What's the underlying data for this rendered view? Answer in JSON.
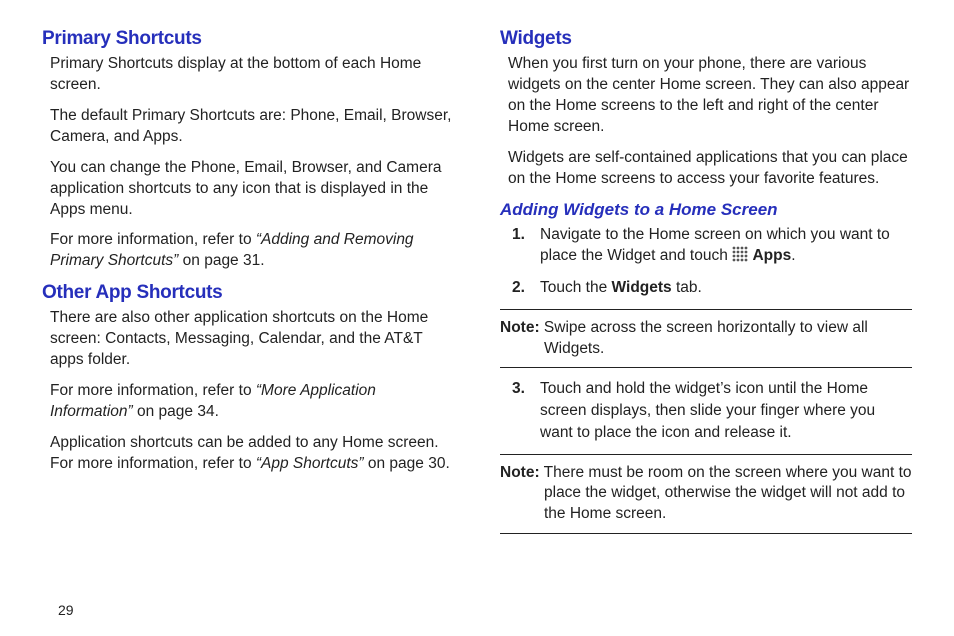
{
  "page_number": "29",
  "left": {
    "primary": {
      "heading": "Primary Shortcuts",
      "p1": "Primary Shortcuts display at the bottom of each Home screen.",
      "p2": "The default Primary Shortcuts are: Phone, Email, Browser, Camera, and Apps.",
      "p3": "You can change the Phone, Email, Browser, and Camera application shortcuts to any icon that is displayed in the Apps menu.",
      "p4_pre": "For more information, refer to ",
      "p4_ref": "“Adding and Removing Primary Shortcuts”",
      "p4_post": " on page 31."
    },
    "other": {
      "heading": "Other App Shortcuts",
      "p1": "There are also other application shortcuts on the Home screen: Contacts, Messaging, Calendar, and the AT&T apps folder.",
      "p2_pre": "For more information, refer to ",
      "p2_ref": "“More Application Information”",
      "p2_post": " on page 34.",
      "p3_pre": "Application shortcuts can be added to any Home screen. For more information, refer to ",
      "p3_ref": "“App Shortcuts”",
      "p3_post": " on page 30."
    }
  },
  "right": {
    "widgets": {
      "heading": "Widgets",
      "p1": "When you first turn on your phone, there are various widgets on the center Home screen. They can also appear on the Home screens to the left and right of the center Home screen.",
      "p2": "Widgets are self-contained applications that you can place on the Home screens to access your favorite features."
    },
    "adding": {
      "heading": "Adding Widgets to a Home Screen",
      "step1_num": "1.",
      "step1_pre": "Navigate to the Home screen on which you want to place the Widget and touch ",
      "step1_apps": "Apps",
      "step1_post": ".",
      "step2_num": "2.",
      "step2_pre": "Touch the ",
      "step2_bold": "Widgets",
      "step2_post": " tab.",
      "note1_label": "Note:",
      "note1_text": " Swipe across the screen horizontally to view all Widgets.",
      "step3_num": "3.",
      "step3": "Touch and hold the widget’s icon until the Home screen displays, then slide your finger where you want to place the icon and release it.",
      "note2_label": "Note:",
      "note2_text": " There must be room on the screen where you want to place the widget, otherwise the widget will not add to the Home screen."
    }
  }
}
